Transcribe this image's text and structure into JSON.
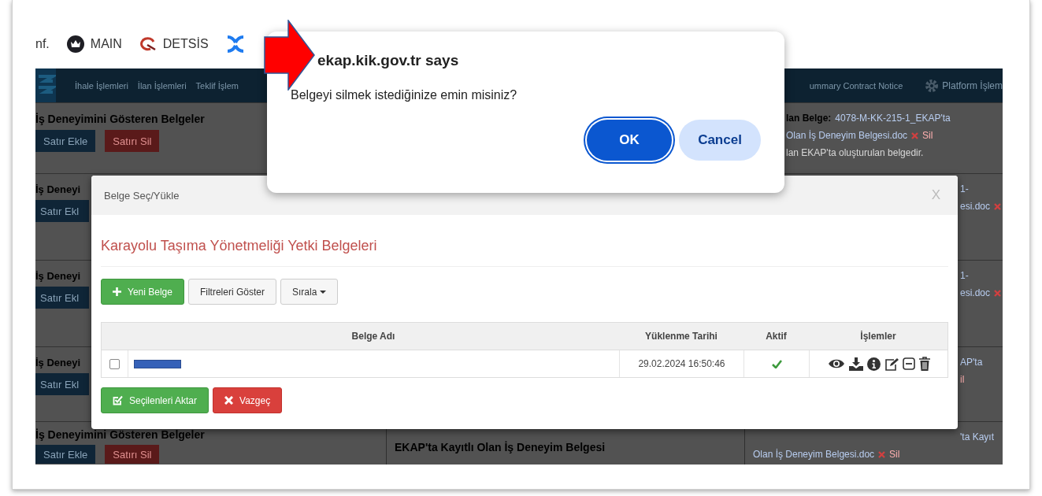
{
  "bookmarks": [
    {
      "kind": "text",
      "label": "nf."
    },
    {
      "kind": "crown",
      "label": "MAIN"
    },
    {
      "kind": "swirl",
      "label": "DETSİS"
    },
    {
      "kind": "cross"
    }
  ],
  "background_page": {
    "nav_items": [
      "İhale İşlemleri",
      "İlan İşlemleri",
      "Teklif İşlem"
    ],
    "nav_right": "ummary Contract Notice",
    "platform_menu": "Platform İşlem",
    "rows": [
      {
        "title": "İş Deneyimini Gösteren Belgeler",
        "buttons": [
          "Satır Ekle",
          "Satırı Sil"
        ],
        "right": [
          [
            {
              "kind": "label",
              "text": "lan Belge:"
            },
            {
              "kind": "link",
              "text": "4078-M-KK-215-1_EKAP'ta"
            }
          ],
          [
            {
              "kind": "link",
              "text": "Olan İş Deneyim Belgesi.doc"
            },
            {
              "kind": "x"
            },
            {
              "kind": "red",
              "text": "Sil"
            }
          ],
          [
            {
              "kind": "note",
              "text": "lan EKAP'ta oluşturulan belgedir."
            }
          ]
        ]
      },
      {
        "title": "İş Deneyi",
        "buttons": [
          "Satır Ekl"
        ],
        "right": [
          [
            {
              "kind": "link",
              "text": "1-"
            }
          ],
          [
            {
              "kind": "link",
              "text": "esi.doc"
            },
            {
              "kind": "x"
            }
          ]
        ]
      },
      {
        "title": "İş Deneyi",
        "buttons": [
          "Satır Ekl"
        ],
        "right": [
          [
            {
              "kind": "link",
              "text": "1-"
            }
          ],
          [
            {
              "kind": "link",
              "text": "esi.doc"
            },
            {
              "kind": "x"
            }
          ]
        ]
      },
      {
        "title": "İş Deneyi",
        "buttons": [
          "Satır Ekl"
        ],
        "right": [
          [
            {
              "kind": "link",
              "text": "AP'ta"
            }
          ],
          [
            {
              "kind": "red",
              "text": "il"
            }
          ]
        ]
      },
      {
        "title": "İş Deneyimini Gösteren Belgeler",
        "buttons": [
          "Satır Ekle",
          "Satırı Sil"
        ],
        "middle": "EKAP'ta Kayıtlı Olan İş Deneyim Belgesi",
        "right": [
          [
            {
              "kind": "link",
              "text": "'ta Kayıt"
            }
          ],
          [
            {
              "kind": "link",
              "text": "Olan İş Deneyim Belgesi.doc"
            },
            {
              "kind": "x"
            },
            {
              "kind": "red",
              "text": "Sil"
            }
          ]
        ]
      }
    ]
  },
  "dialog": {
    "title": "Belge Seç/Yükle",
    "close": "X",
    "heading": "Karayolu Taşıma Yönetmeliği Yetki Belgeleri",
    "toolbar": {
      "new": "Yeni Belge",
      "filters": "Filtreleri Göster",
      "sort": "Sırala"
    },
    "table": {
      "columns": [
        "Belge Adı",
        "Yüklenme Tarihi",
        "Aktif",
        "İşlemler"
      ],
      "rows": [
        {
          "checked": false,
          "uploaded": "29.02.2024 16:50:46",
          "active": true
        }
      ]
    },
    "buttons": {
      "transfer": "Seçilenleri Aktar",
      "cancel": "Vazgeç"
    }
  },
  "alert": {
    "title": "ekap.kik.gov.tr says",
    "message": "Belgeyi silmek istediğinize emin misiniz?",
    "buttons": [
      "OK",
      "Cancel"
    ]
  }
}
